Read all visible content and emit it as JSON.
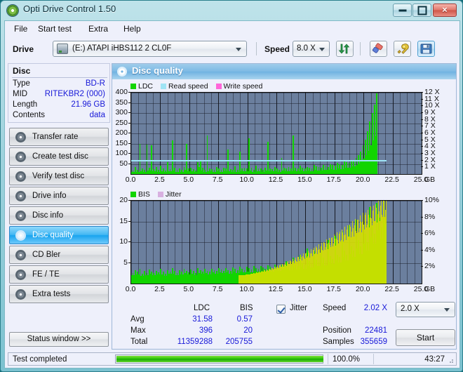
{
  "window": {
    "title": "Opti Drive Control 1.50",
    "icon": "disc-icon",
    "buttons": {
      "minimize": "minimize-icon",
      "maximize": "maximize-icon",
      "close": "close-icon"
    }
  },
  "menu": {
    "items": [
      "File",
      "Start test",
      "Extra",
      "Help"
    ]
  },
  "toolbar": {
    "drive_label": "Drive",
    "drive_value": "(E:)  ATAPI iHBS112  2 CL0F",
    "speed_label": "Speed",
    "speed_value": "8.0 X",
    "icons": [
      "refresh-icon",
      "erase-icon",
      "tools-icon",
      "save-icon"
    ]
  },
  "disc": {
    "title": "Disc",
    "rows": [
      {
        "key": "Type",
        "value": "BD-R"
      },
      {
        "key": "MID",
        "value": "RITEKBR2 (000)"
      },
      {
        "key": "Length",
        "value": "21.96 GB"
      },
      {
        "key": "Contents",
        "value": "data"
      }
    ]
  },
  "sidebar": {
    "items": [
      {
        "label": "Transfer rate",
        "selected": false
      },
      {
        "label": "Create test disc",
        "selected": false
      },
      {
        "label": "Verify test disc",
        "selected": false
      },
      {
        "label": "Drive info",
        "selected": false
      },
      {
        "label": "Disc info",
        "selected": false
      },
      {
        "label": "Disc quality",
        "selected": true
      },
      {
        "label": "CD Bler",
        "selected": false
      },
      {
        "label": "FE / TE",
        "selected": false
      },
      {
        "label": "Extra tests",
        "selected": false
      }
    ],
    "status_window_button": "Status window >>"
  },
  "panel": {
    "title": "Disc quality",
    "icon": "disc-quality-icon"
  },
  "stats": {
    "col_headers": [
      "LDC",
      "BIS"
    ],
    "rows": [
      {
        "label": "Avg",
        "ldc": "31.58",
        "bis": "0.57"
      },
      {
        "label": "Max",
        "ldc": "396",
        "bis": "20"
      },
      {
        "label": "Total",
        "ldc": "11359288",
        "bis": "205755"
      }
    ],
    "jitter_label": "Jitter",
    "jitter_checked": true,
    "speed_label": "Speed",
    "speed_value": "2.02 X",
    "speed_select": "2.0 X",
    "position_label": "Position",
    "position_value": "22481",
    "samples_label": "Samples",
    "samples_value": "355659",
    "start_button": "Start"
  },
  "statusbar": {
    "text": "Test completed",
    "percent": "100.0%",
    "progress": 100,
    "time": "43:27"
  },
  "colors": {
    "ldc_green": "#12d400",
    "bis_green": "#12d400",
    "jitter_yellow": "#d8e000",
    "read_speed": "#9fe4f5",
    "write_speed": "#ff66d9",
    "plot_bg": "#6b7f9e",
    "accent_blue": "#1718d8"
  },
  "chart_data": [
    {
      "type": "bar",
      "id": "ldc-chart",
      "title": "",
      "xlabel": "GB",
      "ylabel": "LDC",
      "xlim": [
        0,
        25
      ],
      "ylim": [
        0,
        400
      ],
      "y2lim": [
        0,
        12
      ],
      "y2label": "X",
      "xticks": [
        "0.0",
        "2.5",
        "5.0",
        "7.5",
        "10.0",
        "12.5",
        "15.0",
        "17.5",
        "20.0",
        "22.5",
        "25.0"
      ],
      "yticks": [
        50,
        100,
        150,
        200,
        250,
        300,
        350,
        400
      ],
      "y2ticks": [
        "1 X",
        "2 X",
        "3 X",
        "4 X",
        "5 X",
        "6 X",
        "7 X",
        "8 X",
        "9 X",
        "10 X",
        "11 X",
        "12 X"
      ],
      "legend": [
        {
          "name": "LDC",
          "color": "#12d400"
        },
        {
          "name": "Read speed",
          "color": "#9fe4f5"
        },
        {
          "name": "Write speed",
          "color": "#ff66d9"
        }
      ],
      "legend_position": "top-left",
      "grid": true,
      "data_end_x": 21.96,
      "read_speed_value": 2.02,
      "series": [
        {
          "name": "LDC",
          "color": "#12d400",
          "x": [
            0.1,
            0.3,
            0.5,
            0.7,
            0.9,
            1.1,
            1.3,
            1.5,
            1.7,
            1.9,
            2.1,
            2.3,
            2.5,
            2.7,
            2.9,
            3.1,
            3.3,
            3.5,
            3.7,
            3.9,
            4.1,
            4.3,
            4.5,
            4.7,
            4.9,
            5.1,
            5.3,
            5.5,
            5.7,
            5.9,
            6.1,
            6.3,
            6.5,
            6.7,
            6.9,
            7.1,
            7.3,
            7.5,
            7.7,
            7.9,
            8.1,
            8.3,
            8.5,
            8.7,
            8.9,
            9.1,
            9.3,
            9.5,
            9.7,
            9.9,
            10.1,
            10.3,
            10.5,
            10.7,
            10.9,
            11.1,
            11.3,
            11.5,
            11.7,
            11.9,
            12.1,
            12.3,
            12.5,
            12.7,
            12.9,
            13.1,
            13.3,
            13.5,
            13.7,
            13.9,
            14.1,
            14.3,
            14.5,
            14.7,
            14.9,
            15.1,
            15.3,
            15.5,
            15.7,
            15.9,
            16.1,
            16.3,
            16.5,
            16.7,
            16.9,
            17.1,
            17.3,
            17.5,
            17.7,
            17.9,
            18.1,
            18.3,
            18.5,
            18.7,
            18.9,
            19.1,
            19.3,
            19.5,
            19.7,
            19.9,
            20.1,
            20.3,
            20.5,
            20.7,
            20.9,
            21.1,
            21.3,
            21.5,
            21.7,
            21.9
          ],
          "values": [
            18,
            35,
            22,
            150,
            28,
            20,
            145,
            30,
            142,
            25,
            33,
            22,
            40,
            26,
            18,
            60,
            24,
            165,
            30,
            22,
            28,
            20,
            35,
            150,
            26,
            30,
            24,
            18,
            60,
            70,
            30,
            22,
            190,
            28,
            24,
            20,
            34,
            28,
            22,
            30,
            26,
            120,
            24,
            20,
            38,
            22,
            110,
            28,
            32,
            26,
            175,
            30,
            22,
            40,
            26,
            28,
            22,
            30,
            160,
            28,
            24,
            34,
            28,
            22,
            80,
            30,
            26,
            36,
            28,
            190,
            30,
            26,
            40,
            32,
            28,
            34,
            30,
            26,
            44,
            38,
            34,
            30,
            46,
            40,
            36,
            50,
            44,
            40,
            56,
            50,
            46,
            62,
            58,
            54,
            70,
            66,
            80,
            92,
            110,
            140,
            170,
            210,
            260,
            300,
            340,
            396
          ]
        },
        {
          "name": "Read speed",
          "color": "#9fe4f5",
          "constant_value": 2.02
        }
      ]
    },
    {
      "type": "bar",
      "id": "bis-chart",
      "title": "",
      "xlabel": "GB",
      "ylabel": "BIS",
      "xlim": [
        0,
        25
      ],
      "ylim": [
        0,
        20
      ],
      "y2lim": [
        0,
        10
      ],
      "y2label": "%",
      "xticks": [
        "0.0",
        "2.5",
        "5.0",
        "7.5",
        "10.0",
        "12.5",
        "15.0",
        "17.5",
        "20.0",
        "22.5",
        "25.0"
      ],
      "yticks": [
        5,
        10,
        15,
        20
      ],
      "y2ticks": [
        "2%",
        "4%",
        "6%",
        "8%",
        "10%"
      ],
      "legend": [
        {
          "name": "BIS",
          "color": "#12d400"
        },
        {
          "name": "Jitter",
          "color": "#d8b0e0"
        }
      ],
      "legend_position": "top-left",
      "grid": true,
      "data_end_x": 21.96,
      "series": [
        {
          "name": "BIS",
          "color": "#12d400",
          "x": [
            0.1,
            0.3,
            0.5,
            0.7,
            0.9,
            1.1,
            1.3,
            1.5,
            1.7,
            1.9,
            2.1,
            2.3,
            2.5,
            2.7,
            2.9,
            3.1,
            3.3,
            3.5,
            3.7,
            3.9,
            4.1,
            4.3,
            4.5,
            4.7,
            4.9,
            5.1,
            5.3,
            5.5,
            5.7,
            5.9,
            6.1,
            6.3,
            6.5,
            6.7,
            6.9,
            7.1,
            7.3,
            7.5,
            7.7,
            7.9,
            8.1,
            8.3,
            8.5,
            8.7,
            8.9,
            9.1,
            9.3,
            9.5,
            9.7,
            9.9,
            10.1,
            10.3,
            10.5,
            10.7,
            10.9,
            11.1,
            11.3,
            11.5,
            11.7,
            11.9,
            12.1,
            12.3,
            12.5,
            12.7,
            12.9,
            13.1,
            13.3,
            13.5,
            13.7,
            13.9,
            14.1,
            14.3,
            14.5,
            14.7,
            14.9,
            15.1,
            15.3,
            15.5,
            15.7,
            15.9,
            16.1,
            16.3,
            16.5,
            16.7,
            16.9,
            17.1,
            17.3,
            17.5,
            17.7,
            17.9,
            18.1,
            18.3,
            18.5,
            18.7,
            18.9,
            19.1,
            19.3,
            19.5,
            19.7,
            19.9,
            20.1,
            20.3,
            20.5,
            20.7,
            20.9,
            21.1,
            21.3,
            21.5,
            21.7,
            21.9
          ],
          "values": [
            2.5,
            3.2,
            2.8,
            3.5,
            2.4,
            3.0,
            2.6,
            3.4,
            2.9,
            2.5,
            3.1,
            2.7,
            3.6,
            2.8,
            2.4,
            3.2,
            2.9,
            3.8,
            3.0,
            2.6,
            3.3,
            2.8,
            3.5,
            3.1,
            2.7,
            3.4,
            3.0,
            2.6,
            3.7,
            3.2,
            2.9,
            3.5,
            3.1,
            2.8,
            3.6,
            3.3,
            3.0,
            3.8,
            3.4,
            3.1,
            3.7,
            3.3,
            3.0,
            3.9,
            3.5,
            3.2,
            4.0,
            3.6,
            3.3,
            4.1,
            3.7,
            3.4,
            4.2,
            3.8,
            3.5,
            4.3,
            3.9,
            3.6,
            4.4,
            4.0,
            3.7,
            4.5,
            4.1,
            3.8,
            4.6,
            4.2,
            5.5,
            4.4,
            4.0,
            6.2,
            4.6,
            4.2,
            7.0,
            5.0,
            4.5,
            8.5,
            5.4,
            4.8,
            7.8,
            5.8,
            5.2,
            9.0,
            6.2,
            5.6,
            10.5,
            6.6,
            6.0,
            11.5,
            7.0,
            6.4,
            12.5,
            8.0,
            7.0,
            14.0,
            9.0,
            8.0,
            15.5,
            10.5,
            9.0,
            17.0,
            12.0,
            10.0,
            18.5,
            14.0,
            12.0,
            19.5,
            16.0,
            13.5,
            20,
            18.0
          ]
        },
        {
          "name": "Jitter",
          "color": "#d8e000",
          "note": "overlaid yellow trace rising toward end of disc"
        }
      ]
    }
  ]
}
